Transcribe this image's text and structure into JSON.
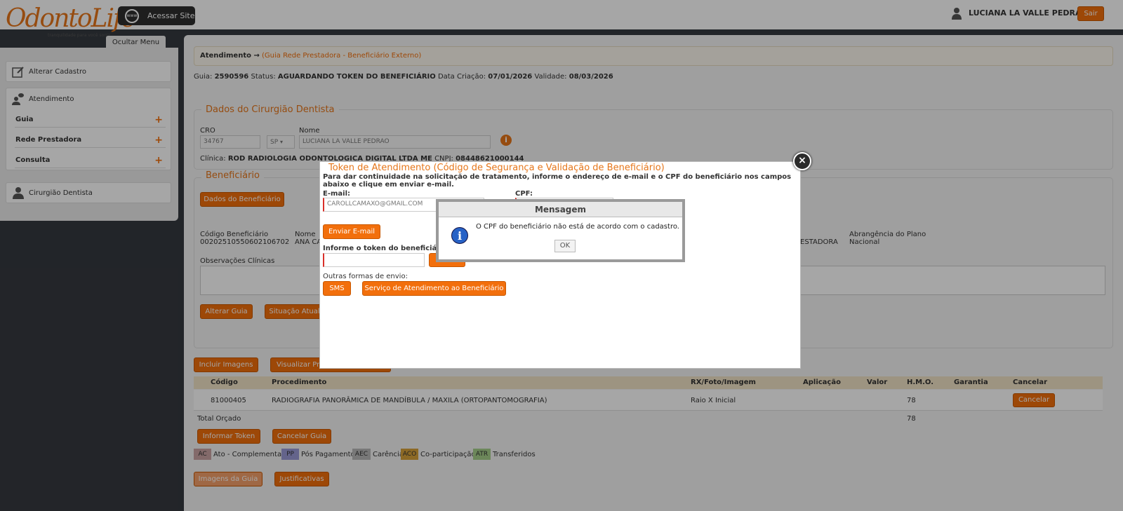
{
  "header": {
    "logo": "OdontoLife",
    "logo_tagline": "tranquilidade para você sorrir",
    "site_button": "Acessar Site",
    "site_icon": "www",
    "user_name": "LUCIANA LA VALLE PEDRAO",
    "logout": "Sair"
  },
  "sidebar": {
    "hide_menu": "Ocultar Menu",
    "alterar_cadastro": "Alterar Cadastro",
    "atendimento": "Atendimento",
    "sub_items": [
      "Guia",
      "Rede Prestadora",
      "Consulta"
    ],
    "cirurgiao": "Cirurgião Dentista"
  },
  "main": {
    "breadcrumb_main": "Atendimento →",
    "breadcrumb_sub": "(Guia Rede Prestadora - Beneficiário Externo)",
    "guia_label": "Guia:",
    "guia_value": "2590596",
    "status_label": "Status:",
    "status_value": "AGUARDANDO TOKEN DO BENEFICIÁRIO",
    "criacao_label": "Data Criação:",
    "criacao_value": "07/01/2026",
    "validade_label": "Validade:",
    "validade_value": "08/03/2026",
    "dentista_legend": "Dados do Cirurgião Dentista",
    "cro_label": "CRO",
    "cro_value": "34767",
    "uf_value": "SP",
    "nome_label": "Nome",
    "nome_value": "LUCIANA LA VALLE PEDRAO",
    "clinica_label": "Clínica:",
    "clinica_value": "ROD RADIOLOGIA ODONTOLOGICA DIGITAL LTDA ME",
    "cnpj_label": "CNPJ:",
    "cnpj_value": "08448621000144",
    "beneficiario_legend": "Beneficiário",
    "dados_beneficiario_btn": "Dados do Beneficiário",
    "codigo_label": "Código Beneficiário",
    "codigo_value": "00202510550602106702",
    "nome_ben_label": "Nome",
    "nome_ben_value": "ANA CA",
    "prestadora_value": "ESTADORA",
    "abrangencia_label": "Abrangência do Plano",
    "abrangencia_value": "Nacional",
    "observacoes_label": "Observações Clínicas",
    "alterar_guia_btn": "Alterar Guia",
    "situacao_btn": "Situação Atual",
    "incluir_imagens_btn": "Incluir Imagens",
    "visualizar_btn": "Visualizar Pr",
    "table_headers": [
      "Código",
      "Procedimento",
      "RX/Foto/Imagem",
      "Aplicação",
      "Valor",
      "H.M.O.",
      "Garantia",
      "Cancelar"
    ],
    "table_row": {
      "codigo": "81000405",
      "procedimento": "RADIOGRAFIA PANORÂMICA DE MANDÍBULA / MAXILA (ORTOPANTOMOGRAFIA)",
      "rx": "Raio X Inicial",
      "hmo": "78",
      "cancelar": "Cancelar"
    },
    "total_label": "Total Orçado",
    "total_hmo": "78",
    "informar_token_btn": "Informar Token",
    "cancelar_guia_btn": "Cancelar Guia",
    "legend_items": [
      {
        "code": "AC",
        "label": "Ato - Complementar",
        "color": "#c9a3a3"
      },
      {
        "code": "PP",
        "label": "Pós Pagamento",
        "color": "#9a9ad6"
      },
      {
        "code": "AEC",
        "label": "Carência",
        "color": "#b8b8b8"
      },
      {
        "code": "ACO",
        "label": "Co-participação",
        "color": "#d8a23a"
      },
      {
        "code": "ATR",
        "label": "Transferidos",
        "color": "#a6cf8a"
      }
    ],
    "imagens_guia_btn": "Imagens da Guia",
    "justificativas_btn": "Justificativas"
  },
  "modal": {
    "title": "Token de Atendimento (Código de Segurança e Validação de Beneficiário)",
    "description": "Para dar continuidade na solicitação de tratamento, informe o endereço de e-mail e o CPF do beneficiário nos campos abaixo e clique em enviar e-mail.",
    "email_label": "E-mail:",
    "email_value": "CAROLLCAMAXO@GMAIL.COM",
    "cpf_label": "CPF:",
    "enviar_btn": "Enviar E-mail",
    "token_label": "Informe o token do beneficiário",
    "outras_label": "Outras formas de envio:",
    "sms_btn": "SMS",
    "sab_btn": "Serviço de Atendimento ao Beneficiário"
  },
  "message": {
    "title": "Mensagem",
    "text": "O CPF do beneficiário não está de acordo com o cadastro.",
    "ok": "OK",
    "icon": "i"
  }
}
